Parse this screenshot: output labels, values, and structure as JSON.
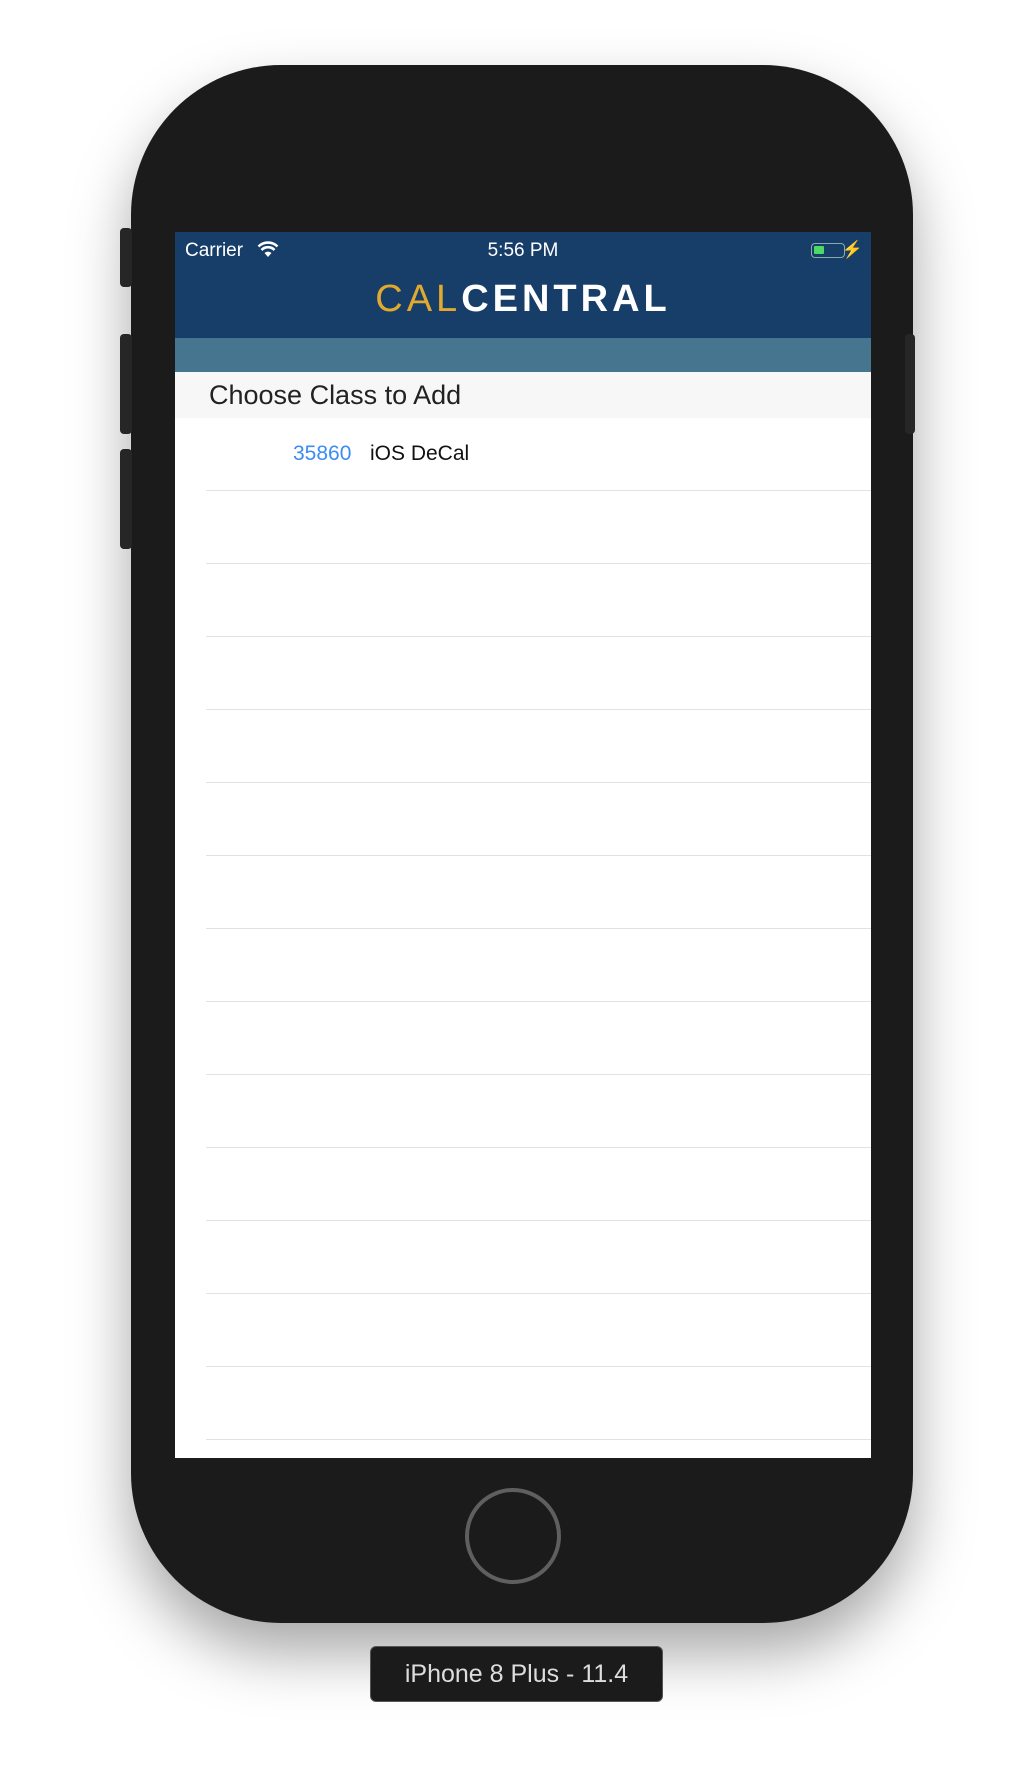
{
  "status_bar": {
    "carrier": "Carrier",
    "time": "5:56 PM",
    "wifi_icon": "wifi-icon",
    "battery_icon": "battery-charging-icon",
    "battery_color": "#4cd964"
  },
  "nav": {
    "logo_cal": "CAL",
    "logo_central": "CENTRAL",
    "background": "#173d69",
    "accent": "#e1a92d"
  },
  "section": {
    "title": "Choose Class to Add"
  },
  "classes": [
    {
      "number": "35860",
      "name": "iOS DeCal"
    }
  ],
  "device_label": "iPhone 8 Plus - 11.4"
}
